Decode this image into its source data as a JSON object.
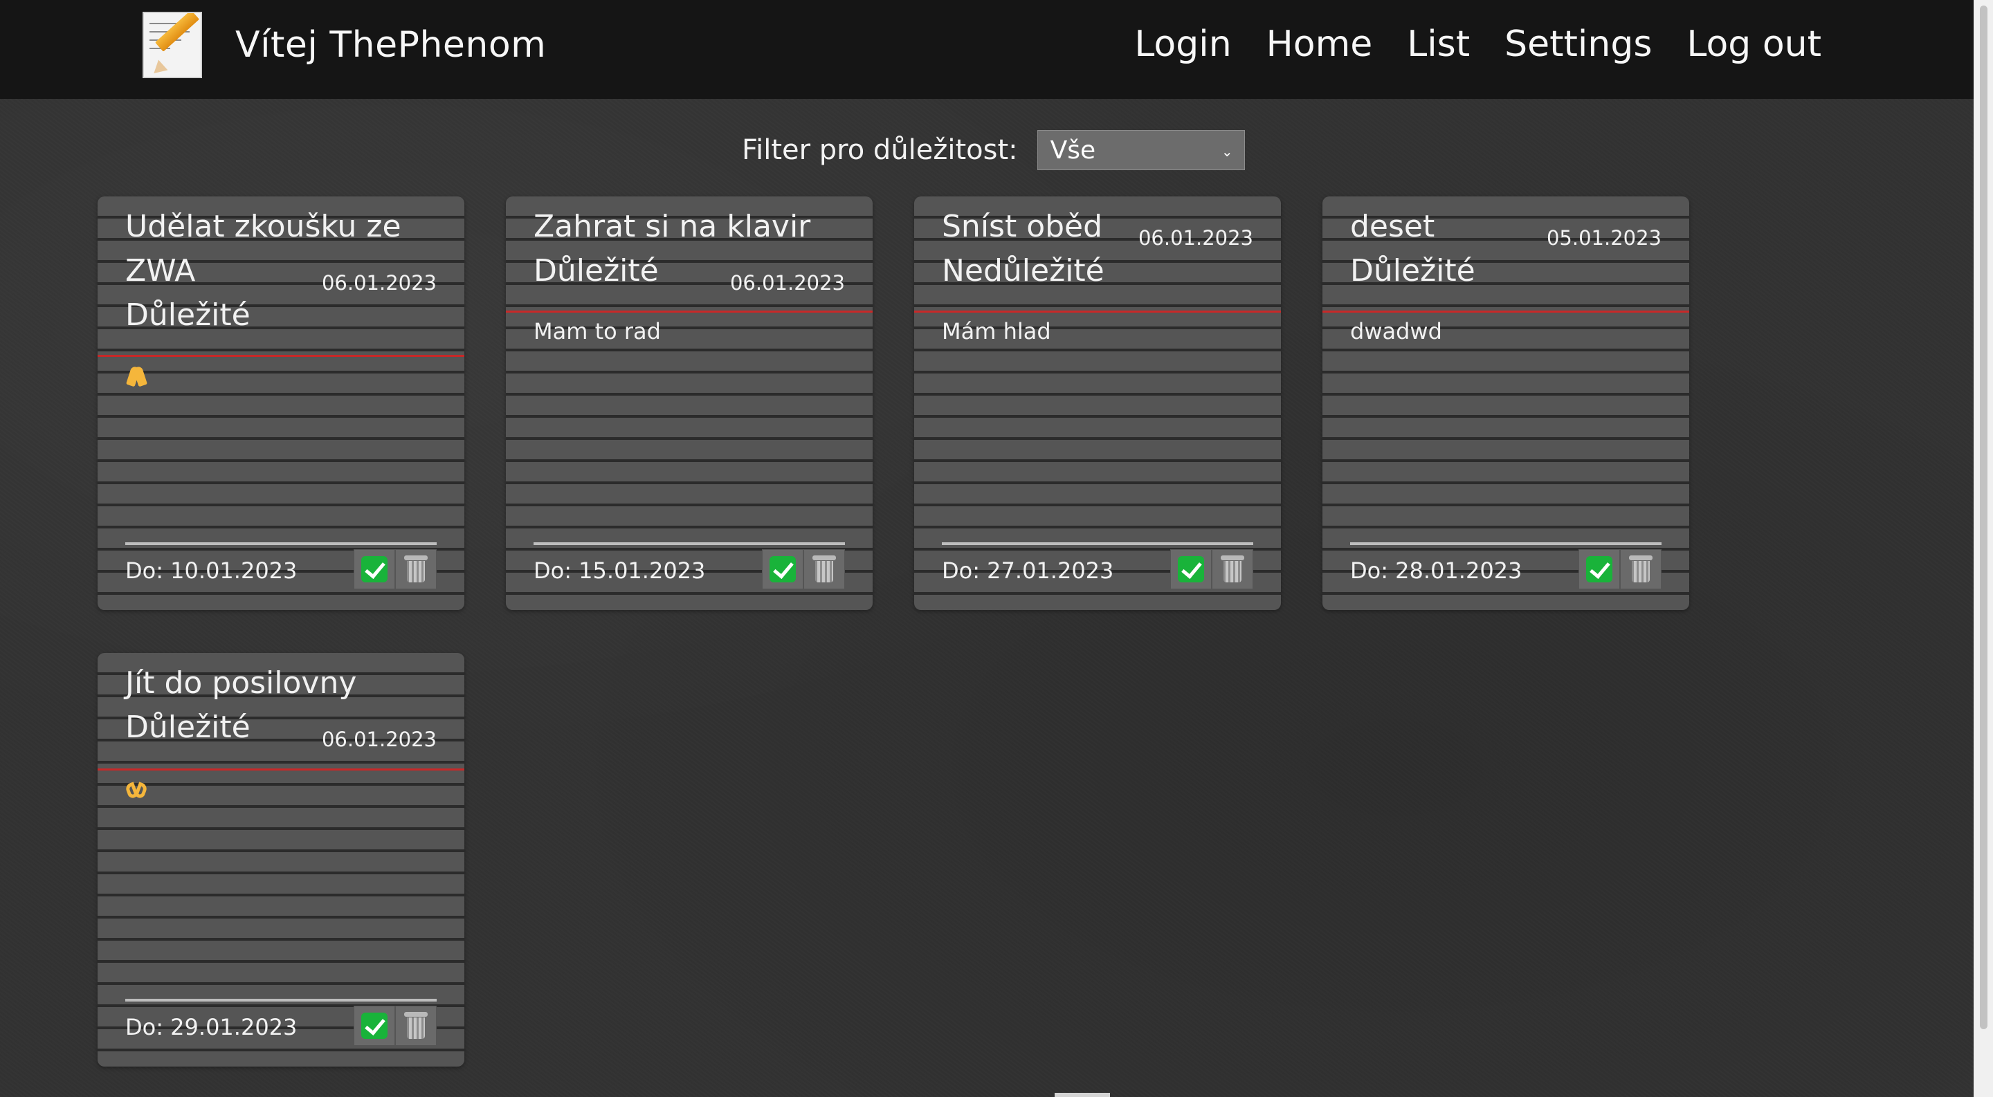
{
  "header": {
    "brand_title": "Vítej ThePhenom",
    "logo_icon": "memo-pencil-icon",
    "nav": [
      "Login",
      "Home",
      "List",
      "Settings",
      "Log out"
    ]
  },
  "filter": {
    "label": "Filter pro důležitost:",
    "selected": "Vše"
  },
  "cards": [
    {
      "title_lines": [
        "Udělat zkoušku ze",
        "ZWA"
      ],
      "importance": "Důležité",
      "created": "06.01.2023",
      "text": "",
      "emoji": "folded-hands-icon",
      "due": "Do: 10.01.2023"
    },
    {
      "title_lines": [
        "Zahrat si na klavir"
      ],
      "importance": "Důležité",
      "created": "06.01.2023",
      "text": "Mam to rad",
      "emoji": "",
      "due": "Do: 15.01.2023"
    },
    {
      "title_lines": [
        "Sníst oběd"
      ],
      "importance": "Nedůležité",
      "created": "06.01.2023",
      "text": "Mám hlad",
      "emoji": "",
      "due": "Do: 27.01.2023"
    },
    {
      "title_lines": [
        "deset"
      ],
      "importance": "Důležité",
      "created": "05.01.2023",
      "text": "dwadwd",
      "emoji": "",
      "due": "Do: 28.01.2023"
    },
    {
      "title_lines": [
        "Jít do posilovny"
      ],
      "importance": "Důležité",
      "created": "06.01.2023",
      "text": "",
      "emoji": "heart-hands-icon",
      "due": "Do: 29.01.2023"
    }
  ],
  "colors": {
    "navbar": "#151515",
    "accent_red": "#c82828",
    "check_green": "#19b33a"
  }
}
